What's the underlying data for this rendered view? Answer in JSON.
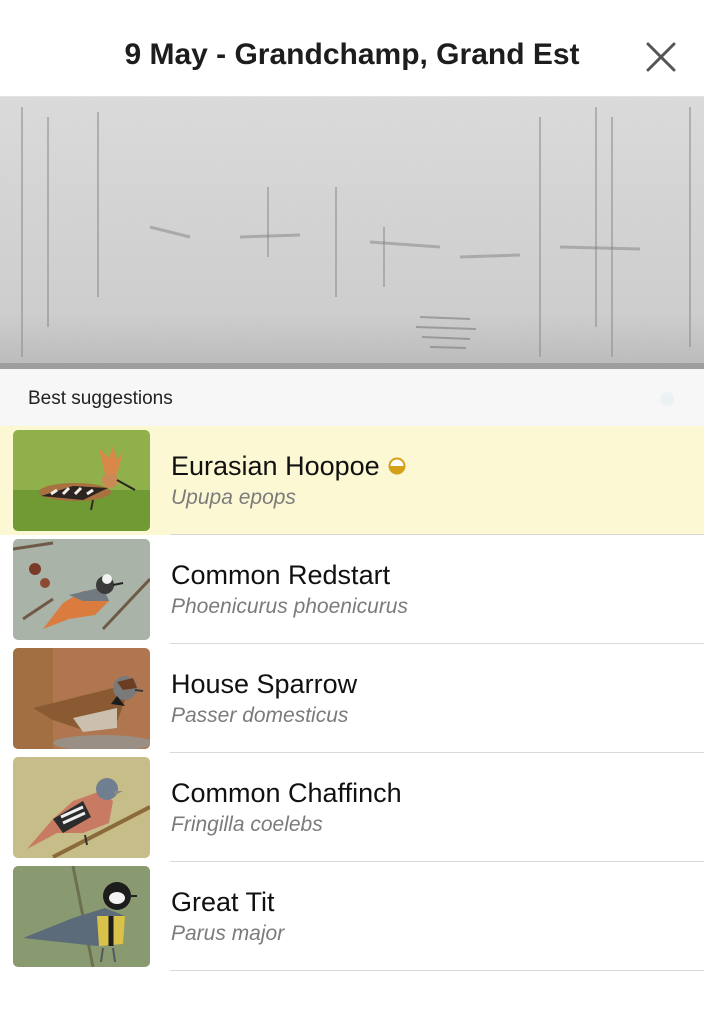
{
  "header": {
    "title": "9 May - Grandchamp, Grand Est",
    "close_icon": "close-icon"
  },
  "spectrogram": {
    "icon": "spectrogram-image"
  },
  "suggestions": {
    "section_label": "Best suggestions",
    "items": [
      {
        "common_name": "Eurasian Hoopoe",
        "scientific_name": "Upupa epops",
        "highlighted": true,
        "badge_icon": "half-circle-confidence-icon",
        "badge_color": "#d4a017"
      },
      {
        "common_name": "Common Redstart",
        "scientific_name": "Phoenicurus phoenicurus",
        "highlighted": false
      },
      {
        "common_name": "House Sparrow",
        "scientific_name": "Passer domesticus",
        "highlighted": false
      },
      {
        "common_name": "Common Chaffinch",
        "scientific_name": "Fringilla coelebs",
        "highlighted": false
      },
      {
        "common_name": "Great Tit",
        "scientific_name": "Parus major",
        "highlighted": false
      }
    ]
  },
  "colors": {
    "highlight_row": "#fbf8d3",
    "section_bg": "#f7f7f7",
    "scientific_name_text": "#7b7b7b"
  }
}
